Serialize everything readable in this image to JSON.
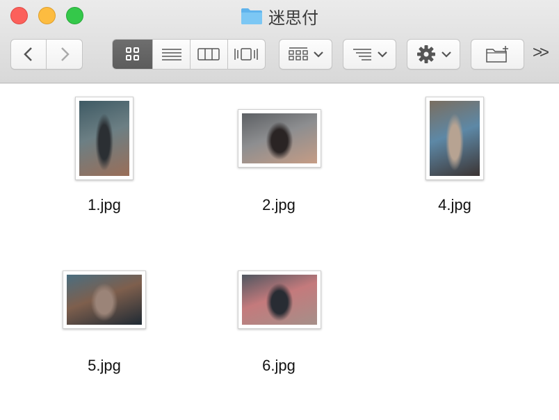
{
  "window": {
    "title": "迷思付"
  },
  "toolbar": {
    "back_label": "Back",
    "forward_label": "Forward",
    "view_modes": [
      "icon-view",
      "list-view",
      "column-view",
      "cover-flow-view"
    ],
    "active_view": "icon-view",
    "overflow_label": ">>"
  },
  "files": [
    {
      "name": "1.jpg",
      "colors": [
        "#3e5a64",
        "#2b2f33",
        "#9a6e58",
        "#6c7f84"
      ]
    },
    {
      "name": "2.jpg",
      "colors": [
        "#5c5f63",
        "#2a2424",
        "#c59c85",
        "#8d8e90"
      ]
    },
    {
      "name": "4.jpg",
      "colors": [
        "#7a6e60",
        "#b7a392",
        "#3c3433",
        "#5d88a6"
      ]
    },
    {
      "name": "5.jpg",
      "colors": [
        "#4a6e80",
        "#9b8478",
        "#1f2a34",
        "#7e5f4d"
      ]
    },
    {
      "name": "6.jpg",
      "colors": [
        "#4f5660",
        "#282c33",
        "#a58f89",
        "#c47a7c"
      ]
    }
  ]
}
